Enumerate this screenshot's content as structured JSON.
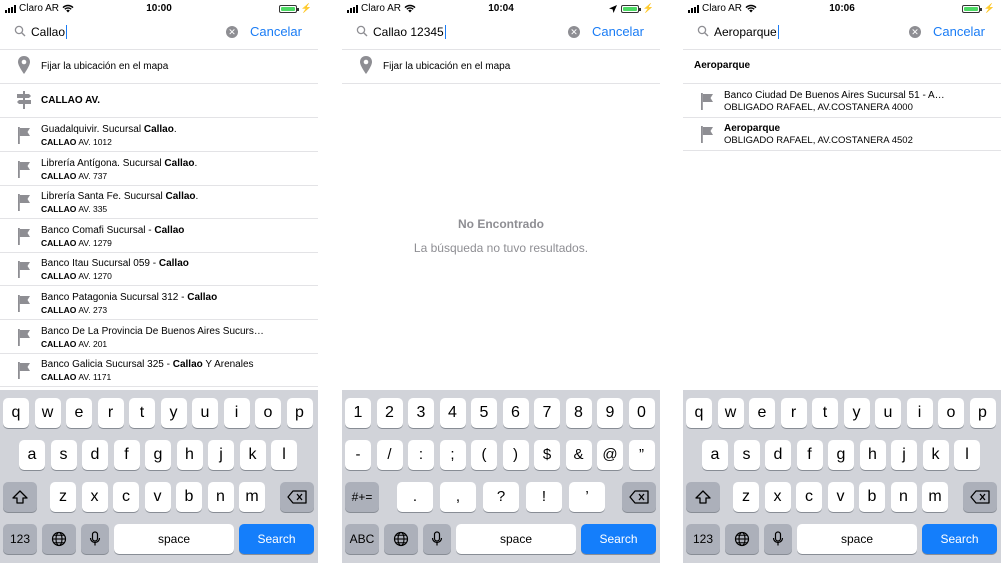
{
  "screens": [
    {
      "status": {
        "carrier": "Claro AR",
        "time": "10:00"
      },
      "search": {
        "query": "Callao",
        "cancel": "Cancelar"
      },
      "fix_location": "Fijar la ubicación en el mapa",
      "street": "CALLAO AV.",
      "results": [
        {
          "pre": "Guadalquivir. Sucursal ",
          "bold": "Callao",
          "post": ".",
          "sub_bold": "CALLAO",
          "sub": " AV. 1012"
        },
        {
          "pre": "Librería Antígona. Sucursal ",
          "bold": "Callao",
          "post": ".",
          "sub_bold": "CALLAO",
          "sub": " AV. 737"
        },
        {
          "pre": "Librería Santa Fe. Sucursal ",
          "bold": "Callao",
          "post": ".",
          "sub_bold": "CALLAO",
          "sub": " AV. 335"
        },
        {
          "pre": "Banco Comafi Sucursal - ",
          "bold": "Callao",
          "post": "",
          "sub_bold": "CALLAO",
          "sub": " AV. 1279"
        },
        {
          "pre": "Banco Itau Sucursal 059 - ",
          "bold": "Callao",
          "post": "",
          "sub_bold": "CALLAO",
          "sub": " AV. 1270"
        },
        {
          "pre": "Banco Patagonia Sucursal 312 - ",
          "bold": "Callao",
          "post": "",
          "sub_bold": "CALLAO",
          "sub": " AV. 273"
        },
        {
          "pre": "Banco De La Provincia De Buenos Aires Sucurs…",
          "bold": "",
          "post": "",
          "sub_bold": "CALLAO",
          "sub": " AV. 201"
        },
        {
          "pre": "Banco Galicia Sucursal 325 - ",
          "bold": "Callao",
          "post": " Y Arenales",
          "sub_bold": "CALLAO",
          "sub": " AV. 1171"
        }
      ]
    },
    {
      "status": {
        "carrier": "Claro AR",
        "time": "10:04"
      },
      "search": {
        "query": "Callao 12345",
        "cancel": "Cancelar"
      },
      "fix_location": "Fijar la ubicación en el mapa",
      "empty_title": "No Encontrado",
      "empty_sub": "La búsqueda no tuvo resultados."
    },
    {
      "status": {
        "carrier": "Claro AR",
        "time": "10:06"
      },
      "search": {
        "query": "Aeroparque",
        "cancel": "Cancelar"
      },
      "section": "Aeroparque",
      "results": [
        {
          "title": "Banco Ciudad De Buenos Aires Sucursal 51 - A…",
          "sub": "OBLIGADO RAFAEL, AV.COSTANERA 4000"
        },
        {
          "title": "Aeroparque",
          "sub": "OBLIGADO RAFAEL, AV.COSTANERA 4502"
        }
      ]
    }
  ],
  "keyboard_alpha": {
    "row1": [
      "q",
      "w",
      "e",
      "r",
      "t",
      "y",
      "u",
      "i",
      "o",
      "p"
    ],
    "row2": [
      "a",
      "s",
      "d",
      "f",
      "g",
      "h",
      "j",
      "k",
      "l"
    ],
    "row3": [
      "z",
      "x",
      "c",
      "v",
      "b",
      "n",
      "m"
    ],
    "mode": "123",
    "space": "space",
    "search": "Search"
  },
  "keyboard_num": {
    "row1": [
      "1",
      "2",
      "3",
      "4",
      "5",
      "6",
      "7",
      "8",
      "9",
      "0"
    ],
    "row2": [
      "-",
      "/",
      ":",
      ";",
      "(",
      ")",
      "$",
      "&",
      "@",
      "”"
    ],
    "row3": [
      ".",
      ",",
      "?",
      "!",
      "’"
    ],
    "more": "#+=",
    "mode": "ABC",
    "space": "space",
    "search": "Search"
  },
  "icons": {
    "search": "magnifier-icon",
    "clear": "clear-icon",
    "pin": "map-pin-icon",
    "street": "signpost-icon",
    "flag": "flag-icon",
    "shift": "shift-icon",
    "delete": "delete-icon",
    "globe": "globe-icon",
    "mic": "microphone-icon",
    "wifi": "wifi-icon",
    "location": "location-arrow-icon",
    "battery": "battery-icon"
  }
}
